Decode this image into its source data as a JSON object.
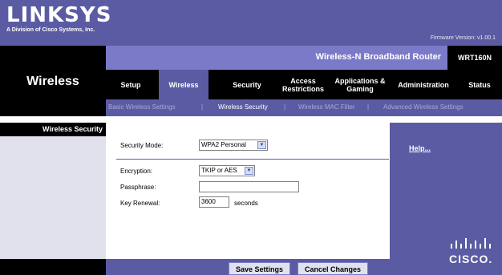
{
  "brand": {
    "logo": "LINKSYS",
    "registered": "®",
    "tagline": "A Division of Cisco Systems, Inc."
  },
  "firmware": "Firmware Version: v1.00.1",
  "product": {
    "name": "Wireless-N Broadband Router",
    "model": "WRT160N"
  },
  "section": "Wireless",
  "tabs": [
    {
      "label": "Setup"
    },
    {
      "label": "Wireless"
    },
    {
      "label": "Security"
    },
    {
      "label": "Access Restrictions"
    },
    {
      "label": "Applications & Gaming"
    },
    {
      "label": "Administration"
    },
    {
      "label": "Status"
    }
  ],
  "subnav": [
    {
      "label": "Basic Wireless Settings"
    },
    {
      "label": "|"
    },
    {
      "label": "Wireless Security"
    },
    {
      "label": "|"
    },
    {
      "label": "Wireless MAC Filter"
    },
    {
      "label": "|"
    },
    {
      "label": "Advanced Wireless Settings"
    }
  ],
  "sidebar_title": "Wireless Security",
  "form": {
    "security_mode": {
      "label": "Security Mode:",
      "value": "WPA2 Personal"
    },
    "encryption": {
      "label": "Encryption:",
      "value": "TKIP or AES"
    },
    "passphrase": {
      "label": "Passphrase:",
      "value": ""
    },
    "key_renewal": {
      "label": "Key Renewal:",
      "value": "3600",
      "unit": "seconds"
    }
  },
  "help_link": "Help...",
  "buttons": {
    "save": "Save Settings",
    "cancel": "Cancel Changes"
  },
  "cisco_word": "CISCO.",
  "colors": {
    "brand_purple": "#5b5ba3",
    "light_purple": "#7a7ac8",
    "black": "#000000"
  }
}
